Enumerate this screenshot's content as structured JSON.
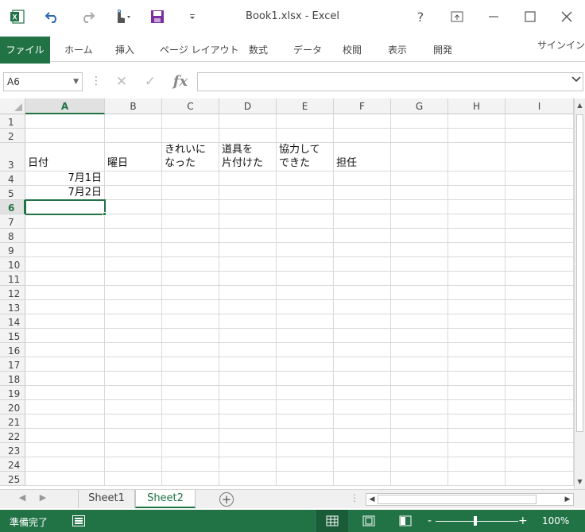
{
  "app": {
    "title": "Book1.xlsx - Excel",
    "help_label": "?"
  },
  "ribbon": {
    "tabs": [
      "ファイル",
      "ホーム",
      "挿入",
      "ページ レイアウト",
      "数式",
      "データ",
      "校閲",
      "表示",
      "開発"
    ],
    "signin": "サインイン"
  },
  "formula_bar": {
    "name_box": "A6",
    "fx_label": "fx",
    "content": ""
  },
  "sheet": {
    "columns": [
      "A",
      "B",
      "C",
      "D",
      "E",
      "F",
      "G",
      "H",
      "I"
    ],
    "selected_column": "A",
    "rows": [
      "1",
      "2",
      "3",
      "4",
      "5",
      "6",
      "7",
      "8",
      "9",
      "10",
      "11",
      "12",
      "13",
      "14",
      "15",
      "16",
      "17",
      "18",
      "19",
      "20",
      "21",
      "22",
      "23",
      "24",
      "25"
    ],
    "selected_row": "6",
    "cells": {
      "A3": "日付",
      "B3": "曜日",
      "C3": "きれいに\nなった",
      "D3": "道具を\n片付けた",
      "E3": "協力して\nできた",
      "F3": "担任",
      "A4": "7月1日",
      "A5": "7月2日"
    }
  },
  "sheet_tabs": [
    "Sheet1",
    "Sheet2"
  ],
  "active_sheet": "Sheet2",
  "status": {
    "ready": "準備完了",
    "zoom": "100%",
    "zoom_minus": "-",
    "zoom_plus": "+"
  },
  "colors": {
    "accent": "#217346"
  }
}
